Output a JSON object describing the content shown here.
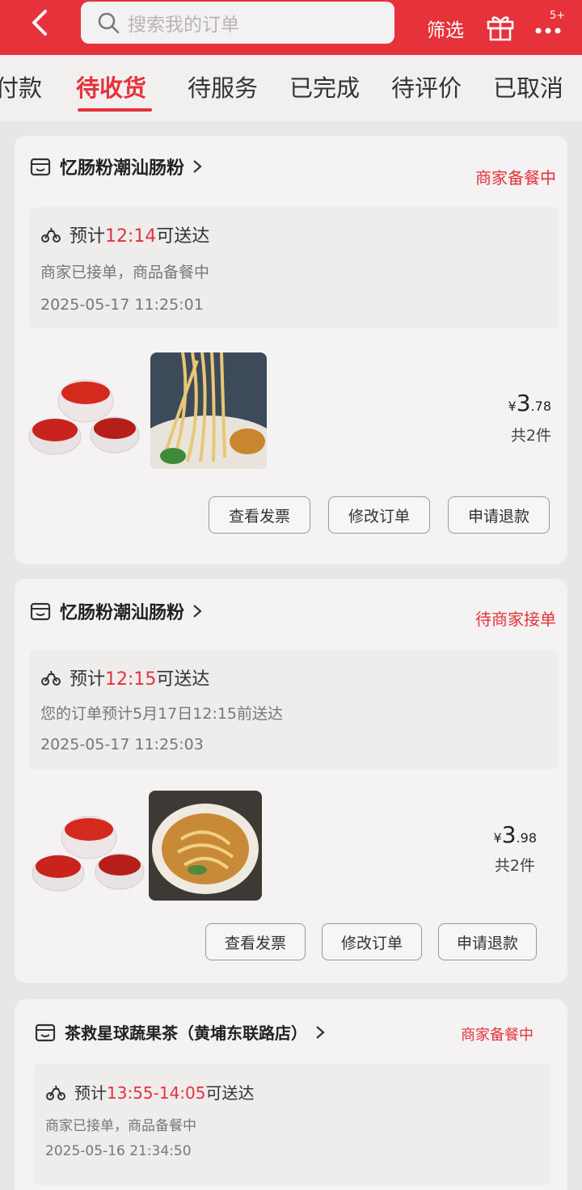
{
  "header": {
    "search_placeholder": "搜索我的订单",
    "filter_label": "筛选",
    "more_badge": "5+"
  },
  "tabs": [
    {
      "label": "付款",
      "active": false
    },
    {
      "label": "待收货",
      "active": true
    },
    {
      "label": "待服务",
      "active": false
    },
    {
      "label": "已完成",
      "active": false
    },
    {
      "label": "待评价",
      "active": false
    },
    {
      "label": "已取消",
      "active": false
    }
  ],
  "orders": [
    {
      "shop": "忆肠粉潮汕肠粉",
      "status": "商家备餐中",
      "eta_prefix": "预计",
      "eta_time": "12:14",
      "eta_suffix": "可送达",
      "message": "商家已接单，商品备餐中",
      "timestamp": "2025-05-17 11:25:01",
      "currency": "¥",
      "price_int": "3",
      "price_dec": ".78",
      "count": "共2件",
      "buttons": [
        "查看发票",
        "修改订单",
        "申请退款"
      ]
    },
    {
      "shop": "忆肠粉潮汕肠粉",
      "status": "待商家接单",
      "eta_prefix": "预计",
      "eta_time": "12:15",
      "eta_suffix": "可送达",
      "message": "您的订单预计5月17日12:15前送达",
      "timestamp": "2025-05-17 11:25:03",
      "currency": "¥",
      "price_int": "3",
      "price_dec": ".98",
      "count": "共2件",
      "buttons": [
        "查看发票",
        "修改订单",
        "申请退款"
      ]
    },
    {
      "shop": "茶救星球蔬果茶（黄埔东联路店）",
      "status": "商家备餐中",
      "eta_prefix": "预计",
      "eta_time": "13:55-14:05",
      "eta_suffix": "可送达",
      "message": "商家已接单，商品备餐中",
      "timestamp": "2025-05-16 21:34:50"
    }
  ],
  "colors": {
    "accent": "#e5323b",
    "background": "#e9e6e6"
  }
}
